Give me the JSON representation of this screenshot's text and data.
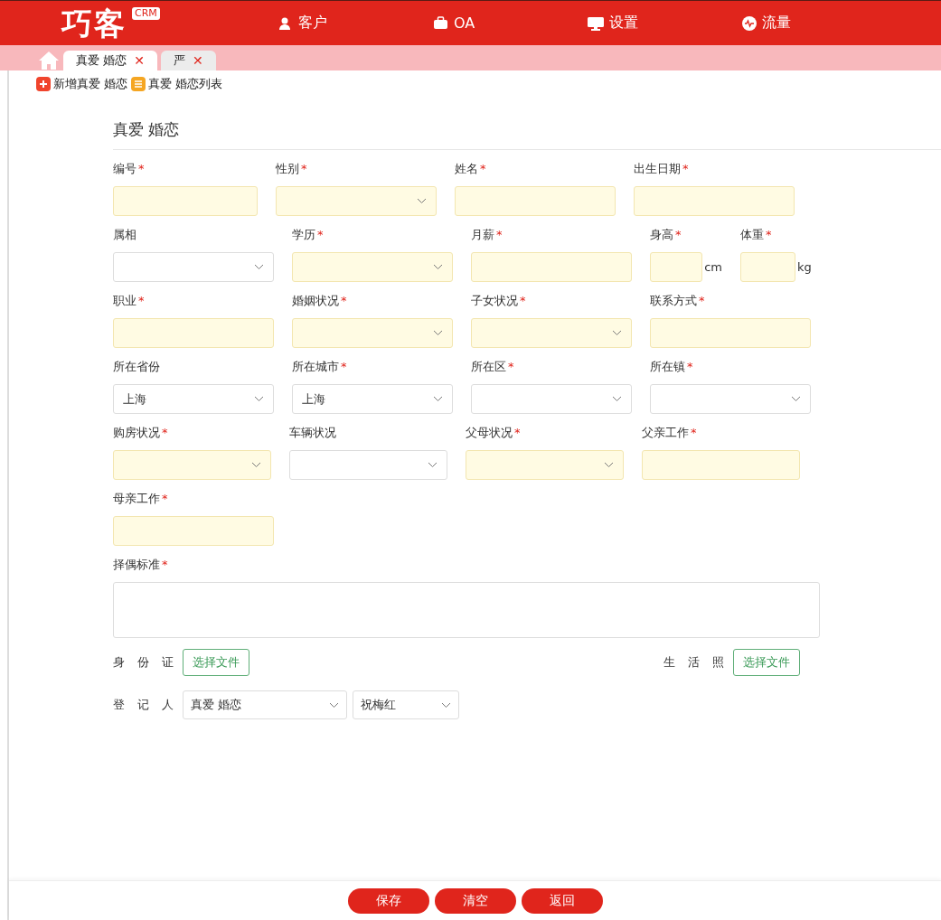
{
  "header": {
    "logo": "巧客",
    "badge": "CRM",
    "nav": [
      {
        "label": "客户"
      },
      {
        "label": "OA"
      },
      {
        "label": "设置"
      },
      {
        "label": "流量"
      }
    ]
  },
  "tabs": [
    {
      "label": "真爱 婚恋",
      "selected": true,
      "close": "✕"
    },
    {
      "label": "严",
      "selected": false,
      "close": "✕"
    }
  ],
  "toolbar": [
    {
      "label": "新增真爱 婚恋"
    },
    {
      "label": "真爱 婚恋列表"
    }
  ],
  "form": {
    "title": "真爱 婚恋",
    "required_mark": "*",
    "rows": [
      [
        {
          "label": "编号",
          "required": true,
          "kind": "input",
          "highlighted": true
        },
        {
          "label": "性别",
          "required": true,
          "kind": "select",
          "highlighted": true
        },
        {
          "label": "姓名",
          "required": true,
          "kind": "input",
          "highlighted": true
        },
        {
          "label": "出生日期",
          "required": true,
          "kind": "input",
          "highlighted": true
        }
      ],
      [
        {
          "label": "属相",
          "required": false,
          "kind": "select",
          "highlighted": false
        },
        {
          "label": "学历",
          "required": true,
          "kind": "select",
          "highlighted": true
        },
        {
          "label": "月薪",
          "required": true,
          "kind": "input",
          "highlighted": true
        },
        {
          "label": "身高",
          "required": true,
          "kind": "small",
          "highlighted": true,
          "unit": "cm"
        },
        {
          "label": "体重",
          "required": true,
          "kind": "small",
          "highlighted": true,
          "unit": "kg"
        }
      ],
      [
        {
          "label": "职业",
          "required": true,
          "kind": "input",
          "highlighted": true
        },
        {
          "label": "婚姻状况",
          "required": true,
          "kind": "select",
          "highlighted": true
        },
        {
          "label": "子女状况",
          "required": true,
          "kind": "select",
          "highlighted": true
        },
        {
          "label": "联系方式",
          "required": true,
          "kind": "input",
          "highlighted": true
        }
      ],
      [
        {
          "label": "所在省份",
          "required": false,
          "kind": "select",
          "highlighted": false,
          "value": "上海"
        },
        {
          "label": "所在城市",
          "required": true,
          "kind": "select",
          "highlighted": false,
          "value": "上海"
        },
        {
          "label": "所在区",
          "required": true,
          "kind": "select",
          "highlighted": false
        },
        {
          "label": "所在镇",
          "required": true,
          "kind": "select",
          "highlighted": false
        }
      ],
      [
        {
          "label": "购房状况",
          "required": true,
          "kind": "select",
          "highlighted": true
        },
        {
          "label": "车辆状况",
          "required": false,
          "kind": "select",
          "highlighted": false
        },
        {
          "label": "父母状况",
          "required": true,
          "kind": "select",
          "highlighted": true
        },
        {
          "label": "父亲工作",
          "required": true,
          "kind": "input",
          "highlighted": true
        }
      ],
      [
        {
          "label": "母亲工作",
          "required": true,
          "kind": "input",
          "highlighted": true
        }
      ]
    ],
    "textarea": {
      "label": "择偶标准",
      "required": true
    },
    "files": [
      {
        "label": "身 份 证",
        "button": "选择文件"
      },
      {
        "label": "生 活 照",
        "button": "选择文件"
      }
    ],
    "registrar": {
      "label": "登 记 人",
      "selects": [
        {
          "value": "真爱 婚恋"
        },
        {
          "value": "祝梅红"
        }
      ]
    }
  },
  "footer": [
    "保存",
    "清空",
    "返回"
  ]
}
